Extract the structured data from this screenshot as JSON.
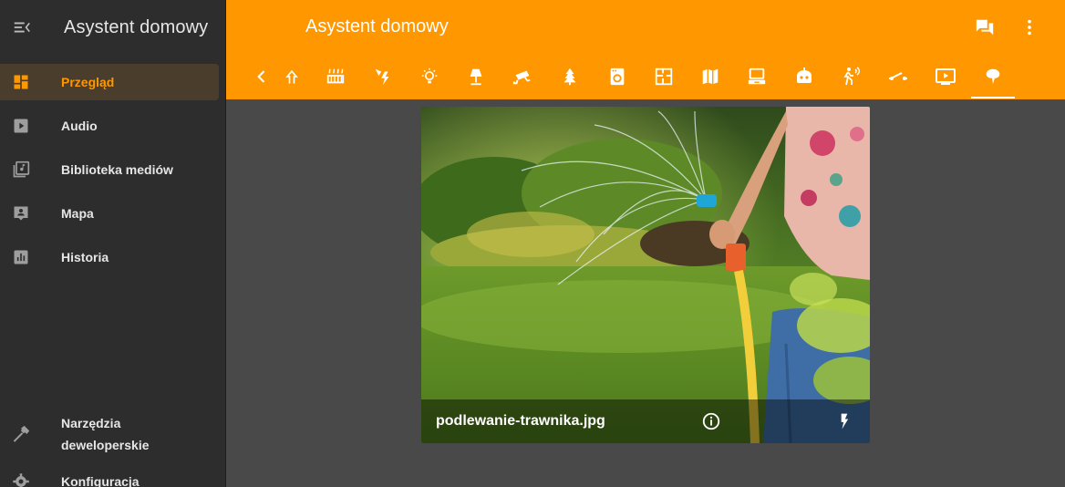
{
  "app": {
    "title": "Asystent domowy"
  },
  "sidebar": {
    "items": [
      {
        "label": "Przegląd",
        "icon": "dashboard-icon"
      },
      {
        "label": "Audio",
        "icon": "play-box-icon"
      },
      {
        "label": "Biblioteka mediów",
        "icon": "music-library-icon"
      },
      {
        "label": "Mapa",
        "icon": "map-account-icon"
      },
      {
        "label": "Historia",
        "icon": "chart-box-icon"
      }
    ],
    "bottom_items": [
      {
        "label_line1": "Narzędzia",
        "label_line2": "deweloperskie",
        "icon": "hammer-icon"
      },
      {
        "label": "Konfiguracja",
        "icon": "gear-icon"
      }
    ]
  },
  "header": {
    "title": "Asystent domowy"
  },
  "tabs": [
    "back-icon",
    "stairs-icon",
    "radiator-icon",
    "electricity-icon",
    "bulb-icon",
    "lamp-icon",
    "cctv-icon",
    "tree-icon",
    "washing-machine-icon",
    "floor-plan-icon",
    "map-icon",
    "laptop-icon",
    "robot-vacuum-icon",
    "motion-sensor-icon",
    "switch-icon",
    "media-player-icon",
    "water-drop-icon"
  ],
  "card": {
    "filename": "podlewanie-trawnika.jpg"
  },
  "colors": {
    "accent": "#ff9800",
    "sidebar": "#2d2d2d",
    "background": "#494949"
  }
}
